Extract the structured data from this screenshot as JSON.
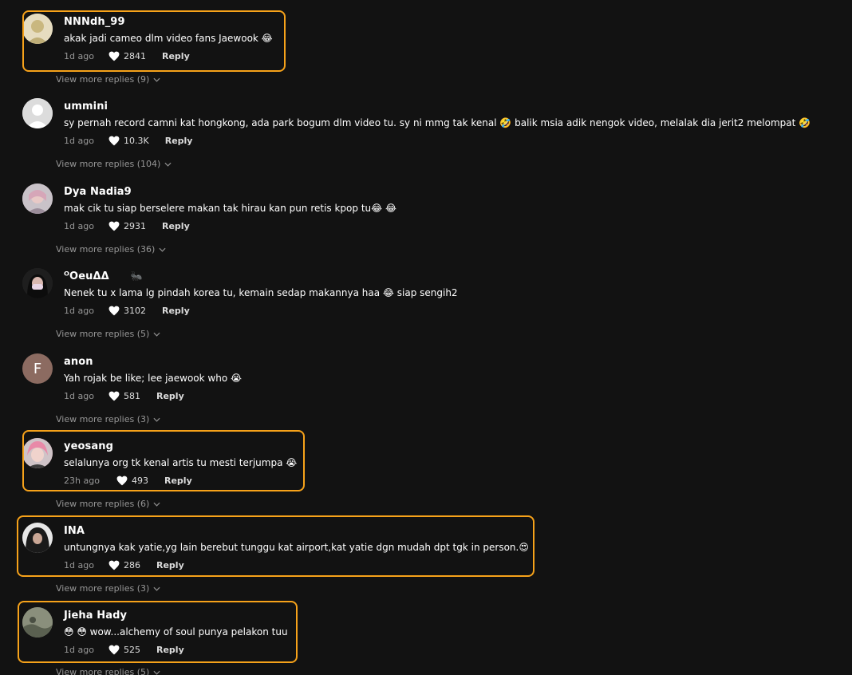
{
  "comments": [
    {
      "username": "NNNdh_99",
      "text": "akak jadi cameo dlm video fans Jaewook 😂",
      "age": "1d ago",
      "likes": "2841",
      "reply_label": "Reply",
      "view_more": "View more replies (9)",
      "avatar_color": "#c8b98a"
    },
    {
      "username": "ummini",
      "text": "sy pernah record camni kat hongkong, ada park bogum dlm video tu. sy ni mmg tak kenal 🤣  balik msia adik nengok video, melalak dia jerit2 melompat 🤣",
      "age": "1d ago",
      "likes": "10.3K",
      "reply_label": "Reply",
      "view_more": "View more replies (104)",
      "avatar_color": "#d9d9d9"
    },
    {
      "username": "Dya Nadia9",
      "text": "mak cik tu siap berselere makan tak hirau kan pun retis kpop tu😂 😂",
      "age": "1d ago",
      "likes": "2931",
      "reply_label": "Reply",
      "view_more": "View more replies (36)",
      "avatar_color": "#b7a7b3"
    },
    {
      "username": "ᴼOeuΔΔ",
      "username_suffix": "🐜",
      "text": "Nenek tu x lama lg pindah korea tu, kemain sedap makannya haa 😂  siap sengih2",
      "age": "1d ago",
      "likes": "3102",
      "reply_label": "Reply",
      "view_more": "View more replies (5)",
      "avatar_color": "#2a2a2a"
    },
    {
      "username": "anon",
      "text": "Yah rojak be like; lee jaewook who 😭",
      "age": "1d ago",
      "likes": "581",
      "reply_label": "Reply",
      "view_more": "View more replies (3)",
      "avatar_color": "#8c6b61",
      "avatar_letter": "F"
    },
    {
      "username": "yeosang",
      "text": "selalunya org tk kenal artis tu mesti terjumpa 😭",
      "age": "23h ago",
      "likes": "493",
      "reply_label": "Reply",
      "view_more": "View more replies (6)",
      "avatar_color": "#d98ca0"
    },
    {
      "username": "INA",
      "text": "untungnya kak yatie,yg lain berebut tunggu kat airport,kat yatie dgn mudah dpt tgk in person.😍",
      "age": "1d ago",
      "likes": "286",
      "reply_label": "Reply",
      "view_more": "View more replies (3)",
      "avatar_color": "#3a3a3a"
    },
    {
      "username": "Jieha Hady",
      "text": "😳 😳 wow...alchemy of soul punya pelakon tuu",
      "age": "1d ago",
      "likes": "525",
      "reply_label": "Reply",
      "view_more": "View more replies (5)",
      "avatar_color": "#6d7563"
    }
  ],
  "colors": {
    "background": "#121212",
    "highlight": "#f6a21a",
    "muted_text": "#8a8a8a"
  }
}
